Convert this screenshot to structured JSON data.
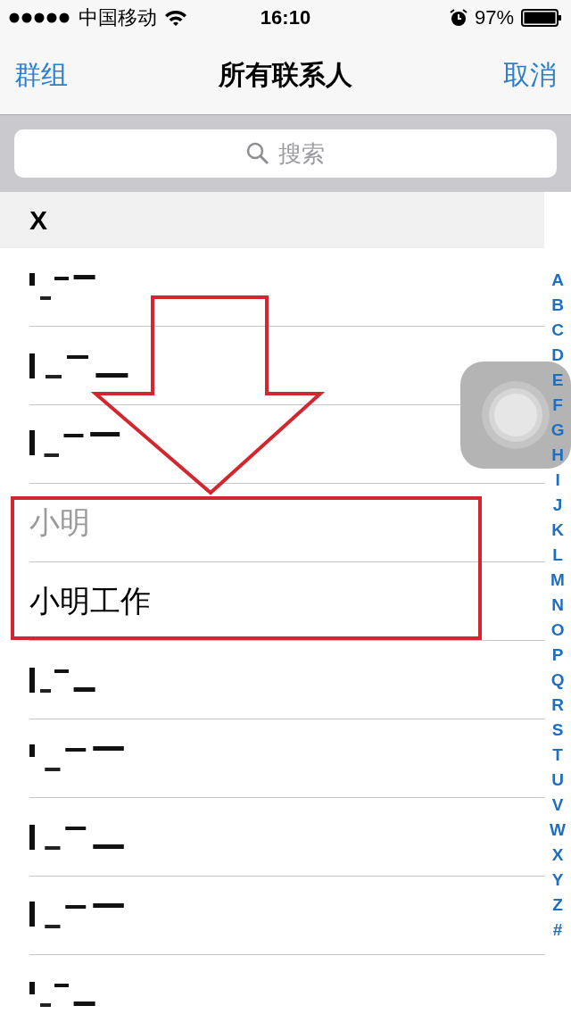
{
  "status_bar": {
    "carrier": "中国移动",
    "time": "16:10",
    "battery_percent": "97%"
  },
  "nav_bar": {
    "left_button": "群组",
    "title": "所有联系人",
    "right_button": "取消"
  },
  "search": {
    "placeholder": "搜索"
  },
  "section": {
    "header": "X",
    "rows": [
      {
        "kind": "redacted"
      },
      {
        "kind": "redacted"
      },
      {
        "kind": "redacted"
      },
      {
        "kind": "name",
        "name": "小明",
        "dimmed": true
      },
      {
        "kind": "name",
        "name": "小明工作",
        "dimmed": false
      },
      {
        "kind": "redacted"
      },
      {
        "kind": "redacted"
      },
      {
        "kind": "redacted"
      },
      {
        "kind": "redacted"
      },
      {
        "kind": "redacted"
      }
    ]
  },
  "index": [
    "A",
    "B",
    "C",
    "D",
    "E",
    "F",
    "G",
    "H",
    "I",
    "J",
    "K",
    "L",
    "M",
    "N",
    "O",
    "P",
    "Q",
    "R",
    "S",
    "T",
    "U",
    "V",
    "W",
    "X",
    "Y",
    "Z",
    "#"
  ]
}
